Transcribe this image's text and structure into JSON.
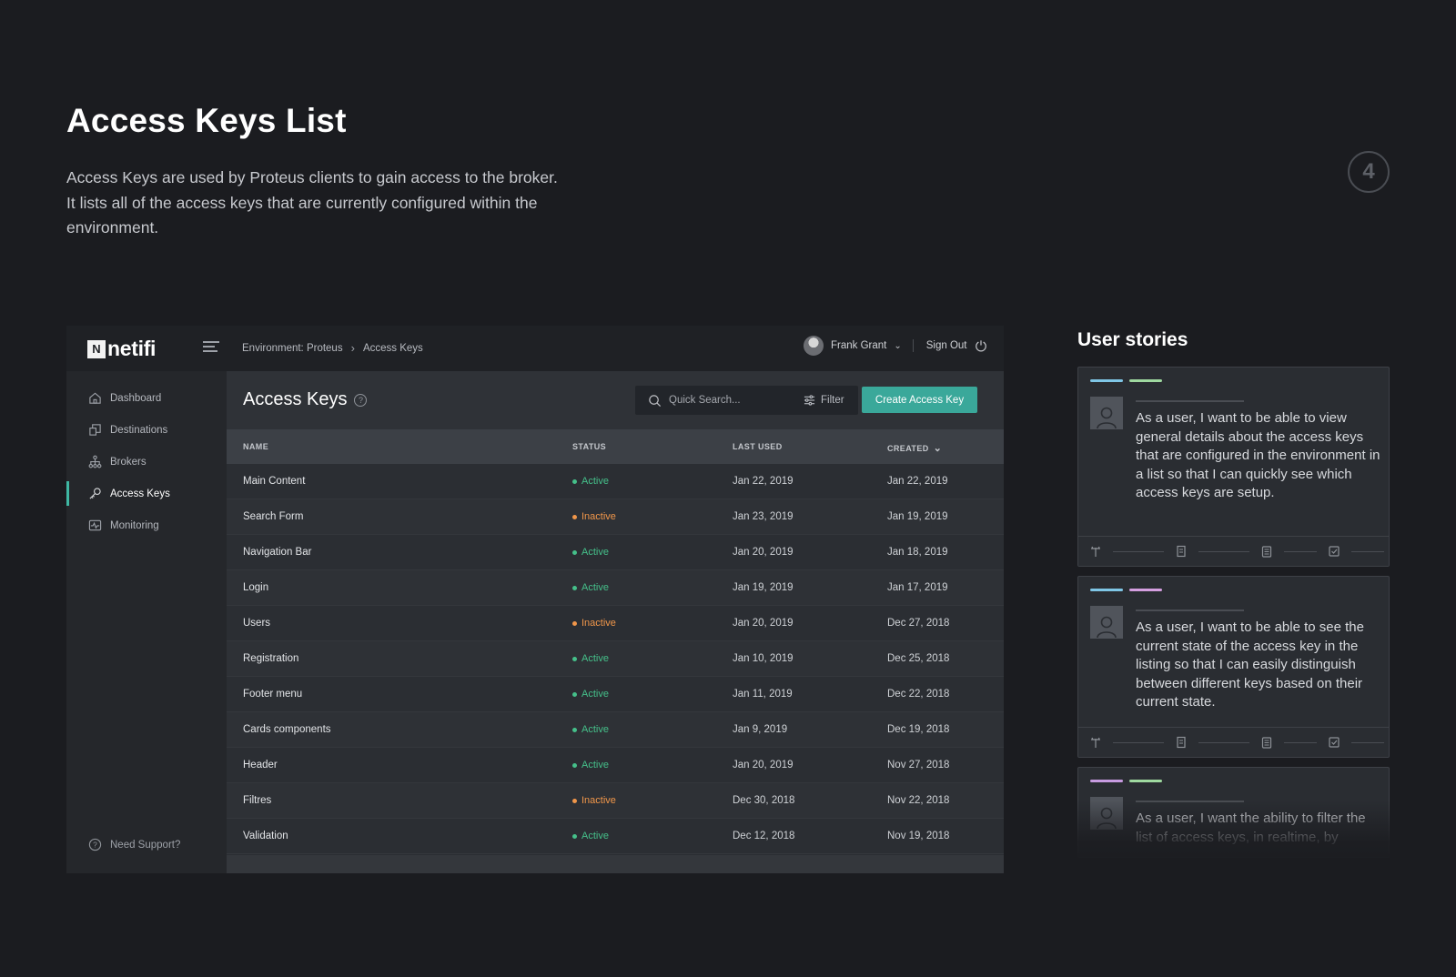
{
  "intro": {
    "title": "Access Keys List",
    "description": "Access Keys are used by Proteus clients to gain access to the broker. It lists all of the access keys that are currently configured within the environment.",
    "step_number": "4"
  },
  "app": {
    "logo_text": "netifi",
    "logo_mark": "N",
    "breadcrumb": [
      "Environment: Proteus",
      "Access Keys"
    ],
    "user_name": "Frank Grant",
    "sign_out_label": "Sign Out",
    "sidebar": {
      "items": [
        {
          "label": "Dashboard",
          "icon": "home-icon",
          "active": false
        },
        {
          "label": "Destinations",
          "icon": "destinations-icon",
          "active": false
        },
        {
          "label": "Brokers",
          "icon": "brokers-icon",
          "active": false
        },
        {
          "label": "Access Keys",
          "icon": "key-icon",
          "active": true
        },
        {
          "label": "Monitoring",
          "icon": "monitoring-icon",
          "active": false
        }
      ],
      "support_label": "Need Support?"
    },
    "page_title": "Access Keys",
    "search_placeholder": "Quick Search...",
    "filter_label": "Filter",
    "create_button_label": "Create Access Key",
    "table": {
      "columns": [
        "NAME",
        "STATUS",
        "LAST USED",
        "CREATED"
      ],
      "rows": [
        {
          "name": "Main Content",
          "status": "Active",
          "last_used": "Jan 22, 2019",
          "created": "Jan 22, 2019"
        },
        {
          "name": "Search Form",
          "status": "Inactive",
          "last_used": "Jan 23, 2019",
          "created": "Jan 19, 2019"
        },
        {
          "name": "Navigation Bar",
          "status": "Active",
          "last_used": "Jan 20, 2019",
          "created": "Jan 18, 2019"
        },
        {
          "name": "Login",
          "status": "Active",
          "last_used": "Jan 19, 2019",
          "created": "Jan 17, 2019"
        },
        {
          "name": "Users",
          "status": "Inactive",
          "last_used": "Jan 20, 2019",
          "created": "Dec 27, 2018"
        },
        {
          "name": "Registration",
          "status": "Active",
          "last_used": "Jan 10, 2019",
          "created": "Dec 25, 2018"
        },
        {
          "name": "Footer menu",
          "status": "Active",
          "last_used": "Jan 11, 2019",
          "created": "Dec 22, 2018"
        },
        {
          "name": "Cards components",
          "status": "Active",
          "last_used": "Jan 9, 2019",
          "created": "Dec 19, 2018"
        },
        {
          "name": "Header",
          "status": "Active",
          "last_used": "Jan 20, 2019",
          "created": "Nov 27, 2018"
        },
        {
          "name": "Filtres",
          "status": "Inactive",
          "last_used": "Dec 30, 2018",
          "created": "Nov 22, 2018"
        },
        {
          "name": "Validation",
          "status": "Active",
          "last_used": "Dec 12, 2018",
          "created": "Nov 19, 2018"
        }
      ]
    }
  },
  "stories": {
    "title": "User stories",
    "cards": [
      {
        "text": "As a user, I want to be able to view general details about the access keys that are configured in the environment in a list so that I can quickly see which access keys are setup.",
        "tags": [
          "#7fc6e6",
          "#9fd9a0"
        ]
      },
      {
        "text": "As a user, I want to be able to see the current state of the access key in the listing so that I can easily distinguish between different keys based on their current state.",
        "tags": [
          "#7fc6e6",
          "#d59fe0"
        ]
      },
      {
        "text": "As a user, I want the ability to filter the list of access keys, in realtime, by",
        "tags": [
          "#c79be0",
          "#9fd9a0"
        ]
      }
    ]
  },
  "colors": {
    "accent": "#3aa89a",
    "active": "#45c08a",
    "inactive": "#f0964a"
  }
}
